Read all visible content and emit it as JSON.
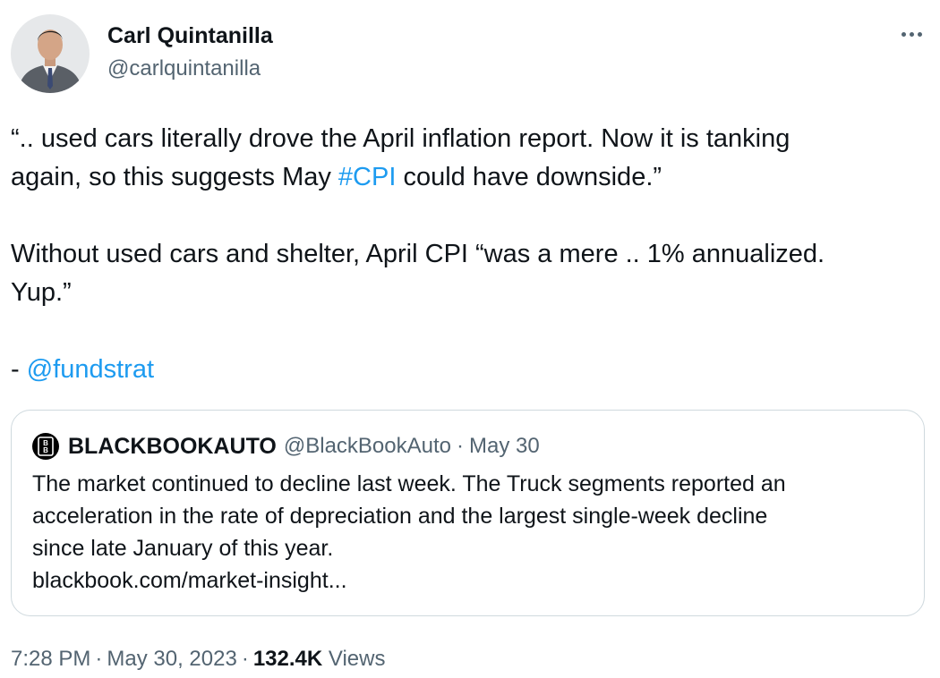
{
  "author": {
    "display_name": "Carl Quintanilla",
    "handle": "@carlquintanilla",
    "avatar_icon": "person-avatar"
  },
  "tweet": {
    "paragraph1": {
      "line1": "“.. used cars literally drove the April inflation report. Now it is tanking",
      "line2_before": "again, so this suggests May ",
      "hashtag": "#CPI",
      "line2_after": " could have downside.”"
    },
    "paragraph2": {
      "line1": "Without used cars and shelter, April CPI “was a mere .. 1% annualized.",
      "line2": "Yup.”"
    },
    "paragraph3": {
      "prefix": "- ",
      "mention": "@fundstrat"
    }
  },
  "quote": {
    "display_name": "BLACKBOOKAUTO",
    "handle": "@BlackBookAuto",
    "separator": "·",
    "date": "May 30",
    "avatar_letters": "B",
    "lines": [
      "The market continued to decline last week. The Truck segments reported an",
      "acceleration in the rate of depreciation and the largest single-week decline",
      "since late January of this year.",
      "blackbook.com/market-insight..."
    ]
  },
  "meta": {
    "time": "7:28 PM",
    "separator": "·",
    "date": "May 30, 2023",
    "views_count": "132.4K",
    "views_label": "Views"
  },
  "colors": {
    "text": "#0f1419",
    "secondary": "#536471",
    "link": "#1d9bf0",
    "border": "#cfd9de"
  }
}
